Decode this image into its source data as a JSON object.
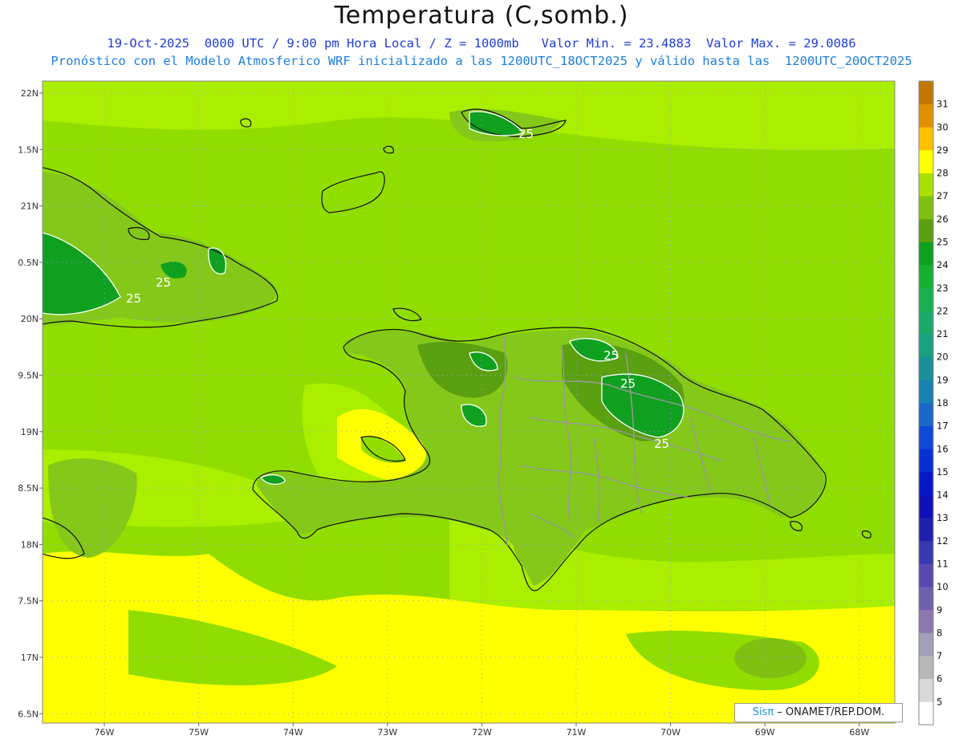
{
  "header": {
    "title": "Temperatura (C,somb.)",
    "line1": "19-Oct-2025  0000 UTC / 9:00 pm Hora Local / Z = 1000mb   Valor Min. = 23.4883  Valor Max. = 29.0086",
    "line2": "Pronóstico con el Modelo Atmosferico WRF inicializado a las 1200UTC_18OCT2025 y válido hasta las  1200UTC_20OCT2025"
  },
  "axes": {
    "lat_labels": [
      "22N",
      "1.5N",
      "21N",
      "0.5N",
      "20N",
      "9.5N",
      "19N",
      "8.5N",
      "18N",
      "7.5N",
      "17N",
      "6.5N"
    ],
    "lon_labels": [
      "76W",
      "75W",
      "74W",
      "73W",
      "72W",
      "71W",
      "70W",
      "69W",
      "68W"
    ]
  },
  "colorbar": {
    "levels": [
      "5",
      "6",
      "7",
      "8",
      "9",
      "10",
      "11",
      "12",
      "13",
      "14",
      "15",
      "16",
      "17",
      "18",
      "19",
      "20",
      "21",
      "22",
      "23",
      "24",
      "25",
      "26",
      "27",
      "28",
      "29",
      "30",
      "31"
    ],
    "colors": [
      "#ffffff",
      "#d8d8d8",
      "#b8b8b8",
      "#a0a0b8",
      "#8a78b0",
      "#7060b0",
      "#5848b0",
      "#3838b0",
      "#2020b0",
      "#1010b8",
      "#0818c8",
      "#0830d0",
      "#1048d8",
      "#1868c8",
      "#1a80b0",
      "#1a9098",
      "#18a080",
      "#18a868",
      "#18b050",
      "#14b030",
      "#10a020",
      "#5aa010",
      "#80c010",
      "#a8e000",
      "#ffff00",
      "#ffc000",
      "#e09000",
      "#c07800"
    ],
    "top_color": "#c07800"
  },
  "contour_labels": [
    "25",
    "25",
    "25",
    "25",
    "25",
    "25"
  ],
  "credit": {
    "logo": "Sisπ",
    "text": " – ONAMET/REP.DOM."
  },
  "colors": {
    "ocean_main": "#90dd00",
    "ocean_light": "#aaee00",
    "warm": "#ffff00",
    "land_mid": "#84c81a",
    "land_dark": "#5aa010",
    "land_darkest": "#10a020",
    "coast": "#111111",
    "border": "#999999"
  }
}
